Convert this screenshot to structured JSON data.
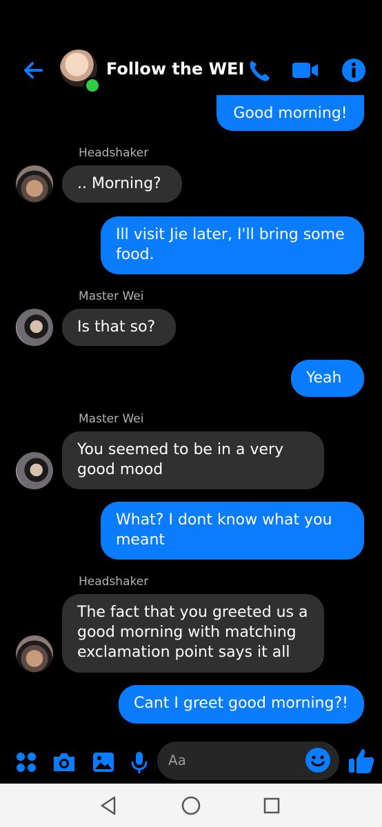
{
  "header": {
    "title": "Follow the WEI"
  },
  "messages": {
    "m1": {
      "text": "Good morning!"
    },
    "m2": {
      "sender": "Headshaker",
      "text": ".. Morning?"
    },
    "m3": {
      "text": "Ill visit Jie later, I'll bring some food."
    },
    "m4": {
      "sender": "Master Wei",
      "text": "Is that so?"
    },
    "m5": {
      "text": "Yeah"
    },
    "m6": {
      "sender": "Master Wei",
      "text": "You seemed to be in a very good mood"
    },
    "m7": {
      "text": "What? I dont know what you meant"
    },
    "m8": {
      "sender": "Headshaker",
      "text": "The fact that you greeted us a good morning with matching exclamation point says it all"
    },
    "m9": {
      "text": "Cant I greet good morning?!"
    }
  },
  "composer": {
    "placeholder": "Aa"
  },
  "colors": {
    "accent": "#0a7cff",
    "incoming": "#303030",
    "online": "#31cc46"
  },
  "icons": [
    "back-arrow-icon",
    "phone-icon",
    "video-icon",
    "info-icon",
    "apps-icon",
    "camera-icon",
    "image-icon",
    "mic-icon",
    "emoji-icon",
    "thumbs-up-icon",
    "nav-back-icon",
    "nav-home-icon",
    "nav-recents-icon"
  ]
}
